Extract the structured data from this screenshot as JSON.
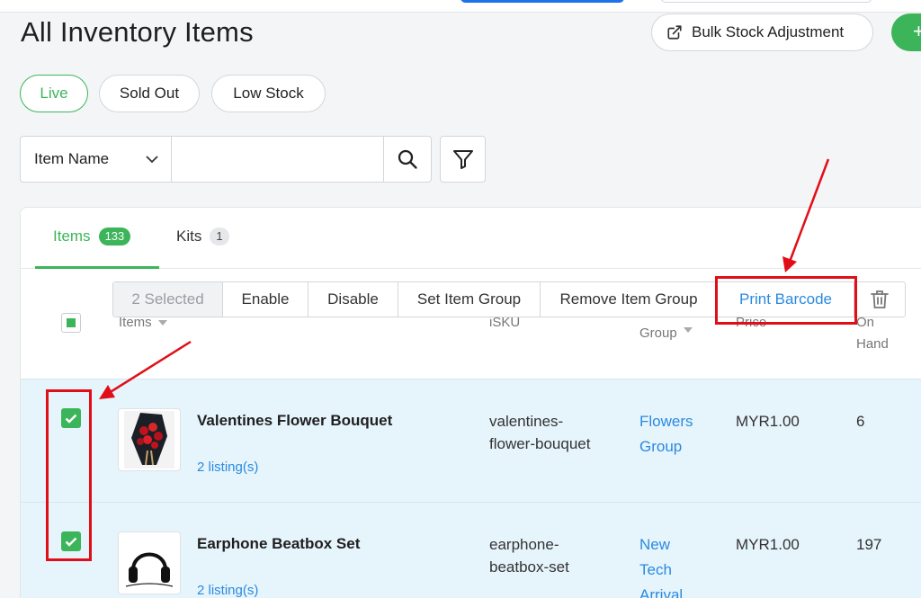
{
  "page": {
    "title": "All Inventory Items"
  },
  "header": {
    "bulk_stock_label": "Bulk Stock Adjustment",
    "add_label": "+"
  },
  "status_filters": [
    {
      "label": "Live",
      "active": true
    },
    {
      "label": "Sold Out",
      "active": false
    },
    {
      "label": "Low Stock",
      "active": false
    }
  ],
  "search": {
    "field_select": "Item Name",
    "query": ""
  },
  "tabs": [
    {
      "label": "Items",
      "count": "133",
      "active": true
    },
    {
      "label": "Kits",
      "count": "1",
      "active": false
    }
  ],
  "bulk_bar": {
    "selected": "2 Selected",
    "enable": "Enable",
    "disable": "Disable",
    "set_group": "Set Item Group",
    "remove_group": "Remove Item Group",
    "print_barcode": "Print Barcode"
  },
  "columns": {
    "items": "Items",
    "sku": "iSKU",
    "group": "Group",
    "price": "Price",
    "on": "On",
    "hand": "Hand"
  },
  "rows": [
    {
      "name": "Valentines Flower Bouquet",
      "listings": "2 listing(s)",
      "sku_line1": "valentines-",
      "sku_line2": "flower-bouquet",
      "group_lines": [
        "Flowers",
        "Group"
      ],
      "price": "MYR1.00",
      "on_hand": "6",
      "checked": true
    },
    {
      "name": "Earphone Beatbox Set",
      "listings": "2 listing(s)",
      "sku_line1": "earphone-",
      "sku_line2": "beatbox-set",
      "group_lines": [
        "New",
        "Tech",
        "Arrival"
      ],
      "price": "MYR1.00",
      "on_hand": "197",
      "checked": true
    }
  ],
  "colors": {
    "accent_green": "#3cb55a",
    "link_blue": "#2b8ae0",
    "highlight_red": "#e10e17",
    "row_selected": "#e6f4fc"
  }
}
